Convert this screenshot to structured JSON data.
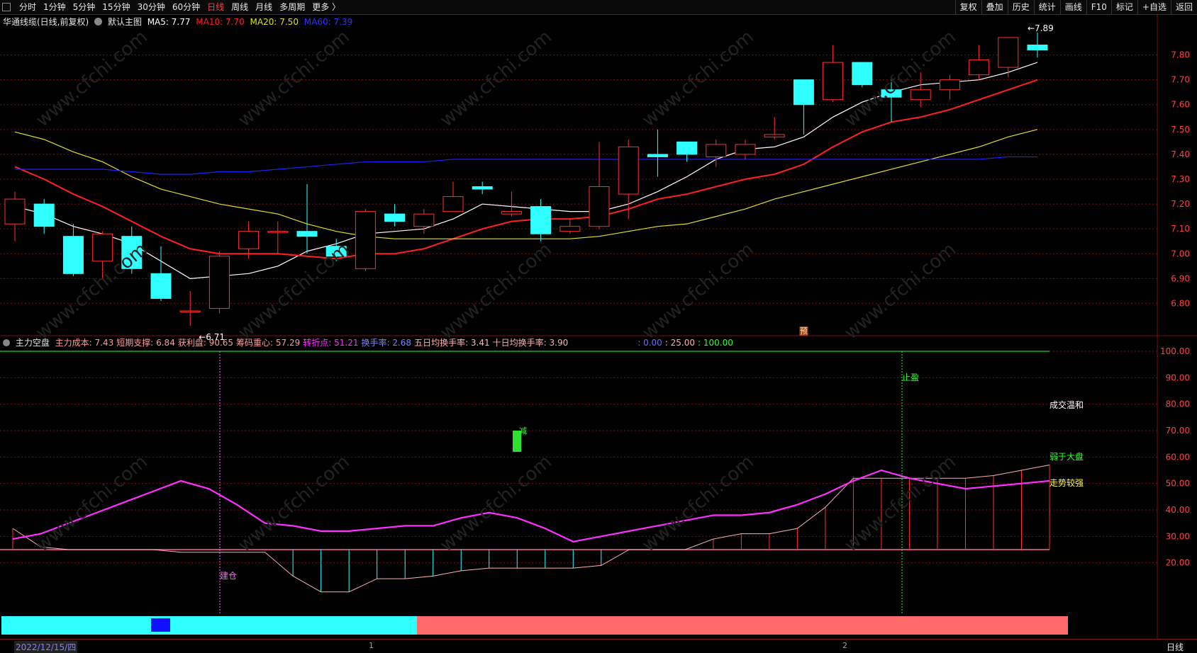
{
  "topbar": {
    "tabs": [
      {
        "label": "分时"
      },
      {
        "label": "1分钟"
      },
      {
        "label": "5分钟"
      },
      {
        "label": "15分钟"
      },
      {
        "label": "30分钟"
      },
      {
        "label": "60分钟"
      },
      {
        "label": "日线",
        "active": true
      },
      {
        "label": "周线"
      },
      {
        "label": "月线"
      },
      {
        "label": "多周期"
      },
      {
        "label": "更多 〉"
      }
    ],
    "right_tools": [
      {
        "label": "复权"
      },
      {
        "label": "叠加"
      },
      {
        "label": "历史"
      },
      {
        "label": "统计"
      },
      {
        "label": "画线"
      },
      {
        "label": "F10"
      },
      {
        "label": "标记"
      },
      {
        "label": "+自选"
      },
      {
        "label": "返回"
      }
    ]
  },
  "main_header": {
    "stock": "华通线缆(日线,前复权)",
    "template": "默认主图",
    "ma5": "MA5: 7.77",
    "ma10": "MA10: 7.70",
    "ma20": "MA20: 7.50",
    "ma60": "MA60: 7.39",
    "colors": {
      "ma5": "#ffffff",
      "ma10": "#ff2020",
      "ma20": "#e0e020",
      "ma60": "#2020ff"
    }
  },
  "sub_header": {
    "name": "主力空盘",
    "items": [
      {
        "text": "主力成本: 7.43",
        "color": "#ff9c9c"
      },
      {
        "text": "短期支撑: 6.84",
        "color": "#ff9c9c"
      },
      {
        "text": "获利盘: 90.65",
        "color": "#ff9c9c"
      },
      {
        "text": "筹码重心: 57.29",
        "color": "#ff9c9c"
      },
      {
        "text": "转折点: 51.21",
        "color": "#ff30ff"
      },
      {
        "text": "换手率: 2.68",
        "color": "#8080ff"
      },
      {
        "text": "五日均换手率: 3.41",
        "color": "#ffb0b0"
      },
      {
        "text": "十日均换手率: 3.90",
        "color": "#ffb0b0"
      }
    ],
    "extra": [
      {
        "text": ": 0.00",
        "color": "#6a6aff"
      },
      {
        "text": ": 25.00",
        "color": "#ffb0b0"
      },
      {
        "text": ": 100.00",
        "color": "#30ff30"
      }
    ]
  },
  "bottom": {
    "date": "2022/12/15/四",
    "marker1": "1",
    "marker2": "2",
    "period": "日线"
  },
  "colors": {
    "up": "#ff3030",
    "down": "#30ffff",
    "bg": "#000000",
    "grid": "#7a1010"
  },
  "chart_data": [
    {
      "type": "candlestick",
      "yticks": [
        "7.80",
        "7.70",
        "7.60",
        "7.50",
        "7.40",
        "7.30",
        "7.20",
        "7.10",
        "7.00",
        "6.90",
        "6.80"
      ],
      "ylim": [
        6.71,
        7.89
      ],
      "annotations": [
        {
          "text": "6.71",
          "candle": 6,
          "type": "low"
        },
        {
          "text": "7.89",
          "candle": 35,
          "type": "high"
        },
        {
          "text": "预",
          "candle": 27
        }
      ],
      "candles": [
        {
          "o": 7.12,
          "h": 7.25,
          "l": 7.05,
          "c": 7.22
        },
        {
          "o": 7.2,
          "h": 7.22,
          "l": 7.08,
          "c": 7.11
        },
        {
          "o": 7.07,
          "h": 7.12,
          "l": 6.91,
          "c": 6.92
        },
        {
          "o": 6.97,
          "h": 7.09,
          "l": 6.9,
          "c": 7.08
        },
        {
          "o": 7.07,
          "h": 7.11,
          "l": 6.92,
          "c": 6.94
        },
        {
          "o": 6.92,
          "h": 7.03,
          "l": 6.81,
          "c": 6.82
        },
        {
          "o": 6.77,
          "h": 6.85,
          "l": 6.71,
          "c": 6.77
        },
        {
          "o": 6.78,
          "h": 7.01,
          "l": 6.76,
          "c": 6.99
        },
        {
          "o": 7.02,
          "h": 7.13,
          "l": 6.98,
          "c": 7.09
        },
        {
          "o": 7.09,
          "h": 7.13,
          "l": 7.0,
          "c": 7.09
        },
        {
          "o": 7.09,
          "h": 7.28,
          "l": 7.0,
          "c": 7.07
        },
        {
          "o": 7.03,
          "h": 7.06,
          "l": 6.97,
          "c": 6.99
        },
        {
          "o": 6.94,
          "h": 7.18,
          "l": 6.93,
          "c": 7.17
        },
        {
          "o": 7.16,
          "h": 7.2,
          "l": 7.11,
          "c": 7.13
        },
        {
          "o": 7.11,
          "h": 7.18,
          "l": 7.08,
          "c": 7.16
        },
        {
          "o": 7.17,
          "h": 7.29,
          "l": 7.17,
          "c": 7.23
        },
        {
          "o": 7.27,
          "h": 7.29,
          "l": 7.24,
          "c": 7.26
        },
        {
          "o": 7.16,
          "h": 7.25,
          "l": 7.15,
          "c": 7.17
        },
        {
          "o": 7.19,
          "h": 7.22,
          "l": 7.05,
          "c": 7.08
        },
        {
          "o": 7.09,
          "h": 7.14,
          "l": 7.08,
          "c": 7.11
        },
        {
          "o": 7.11,
          "h": 7.45,
          "l": 7.1,
          "c": 7.27
        },
        {
          "o": 7.24,
          "h": 7.46,
          "l": 7.14,
          "c": 7.43
        },
        {
          "o": 7.4,
          "h": 7.5,
          "l": 7.31,
          "c": 7.39
        },
        {
          "o": 7.45,
          "h": 7.45,
          "l": 7.37,
          "c": 7.4
        },
        {
          "o": 7.39,
          "h": 7.46,
          "l": 7.35,
          "c": 7.44
        },
        {
          "o": 7.4,
          "h": 7.46,
          "l": 7.38,
          "c": 7.44
        },
        {
          "o": 7.47,
          "h": 7.55,
          "l": 7.46,
          "c": 7.48
        },
        {
          "o": 7.7,
          "h": 7.7,
          "l": 7.48,
          "c": 7.6
        },
        {
          "o": 7.62,
          "h": 7.84,
          "l": 7.61,
          "c": 7.77
        },
        {
          "o": 7.77,
          "h": 7.77,
          "l": 7.67,
          "c": 7.68
        },
        {
          "o": 7.66,
          "h": 7.7,
          "l": 7.53,
          "c": 7.63
        },
        {
          "o": 7.62,
          "h": 7.73,
          "l": 7.59,
          "c": 7.66
        },
        {
          "o": 7.66,
          "h": 7.72,
          "l": 7.62,
          "c": 7.7
        },
        {
          "o": 7.72,
          "h": 7.84,
          "l": 7.7,
          "c": 7.78
        },
        {
          "o": 7.75,
          "h": 7.87,
          "l": 7.71,
          "c": 7.87
        },
        {
          "o": 7.84,
          "h": 7.89,
          "l": 7.79,
          "c": 7.82
        }
      ],
      "series": [
        {
          "name": "MA5",
          "color": "#ffffff",
          "values": [
            7.19,
            7.16,
            7.11,
            7.08,
            7.04,
            6.97,
            6.9,
            6.91,
            6.92,
            6.95,
            7.01,
            7.04,
            7.08,
            7.09,
            7.1,
            7.14,
            7.2,
            7.19,
            7.18,
            7.17,
            7.17,
            7.2,
            7.25,
            7.31,
            7.38,
            7.42,
            7.43,
            7.47,
            7.55,
            7.61,
            7.65,
            7.68,
            7.69,
            7.7,
            7.73,
            7.77
          ]
        },
        {
          "name": "MA10",
          "color": "#ff2020",
          "values": [
            7.35,
            7.3,
            7.24,
            7.19,
            7.13,
            7.07,
            7.02,
            7.0,
            7.0,
            7.0,
            6.99,
            6.98,
            7.0,
            7.0,
            7.02,
            7.06,
            7.1,
            7.13,
            7.14,
            7.14,
            7.15,
            7.18,
            7.22,
            7.24,
            7.27,
            7.3,
            7.32,
            7.36,
            7.43,
            7.49,
            7.53,
            7.55,
            7.58,
            7.62,
            7.66,
            7.7
          ]
        },
        {
          "name": "MA20",
          "color": "#e0e020",
          "values": [
            7.49,
            7.46,
            7.41,
            7.37,
            7.31,
            7.26,
            7.23,
            7.2,
            7.18,
            7.16,
            7.12,
            7.09,
            7.07,
            7.06,
            7.06,
            7.06,
            7.06,
            7.06,
            7.06,
            7.06,
            7.07,
            7.09,
            7.11,
            7.12,
            7.15,
            7.18,
            7.22,
            7.25,
            7.28,
            7.31,
            7.34,
            7.37,
            7.4,
            7.43,
            7.47,
            7.5
          ]
        },
        {
          "name": "MA60",
          "color": "#2020ff",
          "values": [
            7.34,
            7.34,
            7.34,
            7.34,
            7.33,
            7.32,
            7.32,
            7.33,
            7.33,
            7.34,
            7.35,
            7.36,
            7.37,
            7.37,
            7.37,
            7.38,
            7.38,
            7.38,
            7.38,
            7.38,
            7.38,
            7.38,
            7.38,
            7.38,
            7.38,
            7.38,
            7.38,
            7.38,
            7.38,
            7.38,
            7.38,
            7.38,
            7.38,
            7.38,
            7.39,
            7.39
          ]
        }
      ]
    },
    {
      "type": "line",
      "yticks": [
        "100.00",
        "90.00",
        "80.00",
        "70.00",
        "60.00",
        "50.00",
        "40.00",
        "30.00",
        "20.00"
      ],
      "ylim": [
        0,
        100
      ],
      "base": 25,
      "labels": [
        {
          "text": "建仓",
          "candle": 7,
          "color": "#ff60ff"
        },
        {
          "text": "减",
          "candle": 17,
          "color": "#30ff30"
        },
        {
          "text": "止盈",
          "candle": 30,
          "color": "#30ff30"
        },
        {
          "text": "成交温和",
          "color": "#ffffff"
        },
        {
          "text": "弱于大盘",
          "color": "#30ff30"
        },
        {
          "text": "走势较强",
          "color": "#ffff30"
        }
      ],
      "series": [
        {
          "name": "转折点",
          "color": "#ff30ff",
          "values": [
            29,
            31,
            35,
            39,
            43,
            47,
            51,
            48,
            42,
            35,
            34,
            32,
            32,
            33,
            34,
            34,
            37,
            39,
            37,
            33,
            28,
            30,
            32,
            34,
            36,
            38,
            38,
            39,
            42,
            46,
            51,
            55,
            52,
            50,
            48,
            49,
            50,
            51
          ]
        },
        {
          "name": "筹码",
          "color": "#ffb0b0",
          "values": [
            33,
            26,
            25,
            25,
            25,
            25,
            24,
            24,
            24,
            24,
            15,
            9,
            9,
            14,
            14,
            15,
            17,
            18,
            18,
            18,
            18,
            19,
            25,
            25,
            25,
            29,
            31,
            31,
            33,
            41,
            52,
            52,
            52,
            52,
            52,
            53,
            55,
            57
          ]
        }
      ]
    }
  ]
}
